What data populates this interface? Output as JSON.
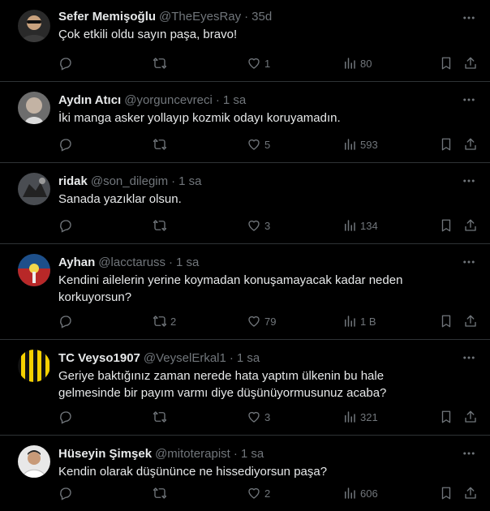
{
  "colors": {
    "background": "#000000",
    "divider": "#2f3336",
    "text": "#e7e9ea",
    "muted": "#71767b"
  },
  "replies": [
    {
      "name": "Sefer Memişoğlu",
      "handle": "@TheEyesRay",
      "time": "35d",
      "text": "Çok etkili oldu sayın paşa, bravo!",
      "replies": "",
      "retweets": "",
      "likes": "1",
      "views": "80"
    },
    {
      "name": "Aydın Atıcı",
      "handle": "@yorguncevreci",
      "time": "1 sa",
      "text": "İki manga asker yollayıp kozmik odayı koruyamadın.",
      "replies": "",
      "retweets": "",
      "likes": "5",
      "views": "593"
    },
    {
      "name": "ridak",
      "handle": "@son_dilegim",
      "time": "1 sa",
      "text": "Sanada yazıklar olsun.",
      "replies": "",
      "retweets": "",
      "likes": "3",
      "views": "134"
    },
    {
      "name": "Ayhan",
      "handle": "@lacctaruss",
      "time": "1 sa",
      "text": "Kendini ailelerin yerine koymadan konuşamayacak kadar neden korkuyorsun?",
      "replies": "",
      "retweets": "2",
      "likes": "79",
      "views": "1 B"
    },
    {
      "name": "TC Veyso1907",
      "handle": "@VeyselErkal1",
      "time": "1 sa",
      "text": "Geriye baktığınız zaman nerede hata yaptım ülkenin bu hale gelmesinde bir payım varmı diye düşünüyormusunuz acaba?",
      "replies": "",
      "retweets": "",
      "likes": "3",
      "views": "321"
    },
    {
      "name": "Hüseyin Şimşek",
      "handle": "@mitoterapist",
      "time": "1 sa",
      "text": "Kendin olarak düşününce ne hissediyorsun paşa?",
      "replies": "",
      "retweets": "",
      "likes": "2",
      "views": "606"
    }
  ],
  "icons": {
    "reply": "speech-bubble-icon",
    "retweet": "repost-arrows-icon",
    "like": "heart-icon",
    "views": "bar-chart-icon",
    "bookmark": "bookmark-icon",
    "share": "share-upload-icon",
    "more": "more-dots-icon"
  }
}
